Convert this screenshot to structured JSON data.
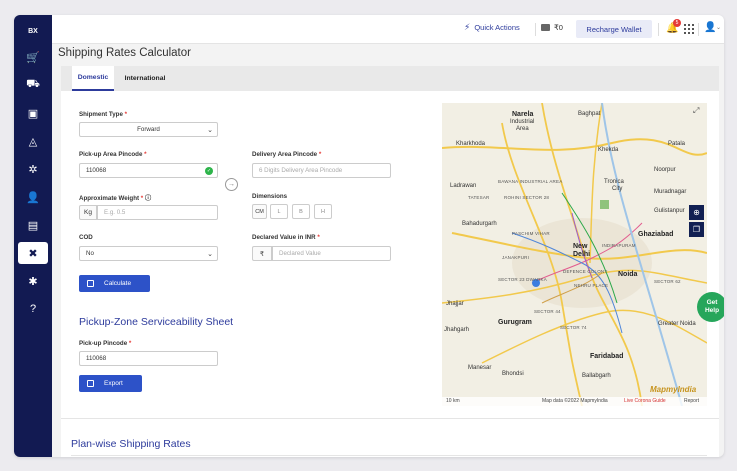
{
  "sidebar": {
    "logo": "BX",
    "items": [
      {
        "icon": "cart-icon",
        "glyph": "🛒"
      },
      {
        "icon": "box-icon",
        "glyph": "⛟"
      },
      {
        "icon": "package-icon",
        "glyph": "▣"
      },
      {
        "icon": "bag-icon",
        "glyph": "◬"
      },
      {
        "icon": "network-icon",
        "glyph": "✲"
      },
      {
        "icon": "user-check-icon",
        "glyph": "👤"
      },
      {
        "icon": "document-icon",
        "glyph": "▤"
      },
      {
        "icon": "tools-icon",
        "glyph": "✖",
        "active": true
      },
      {
        "icon": "settings-icon",
        "glyph": "✱"
      },
      {
        "icon": "help-icon",
        "glyph": "?"
      }
    ]
  },
  "topbar": {
    "quick_actions": "Quick Actions",
    "wallet_balance": "₹0",
    "recharge_label": "Recharge Wallet",
    "notification_count": "5"
  },
  "page": {
    "title": "Shipping Rates Calculator"
  },
  "tabs": [
    {
      "label": "Domestic",
      "active": true
    },
    {
      "label": "International",
      "active": false
    }
  ],
  "form": {
    "shipment_type": {
      "label": "Shipment Type",
      "value": "Forward"
    },
    "pickup_pincode": {
      "label": "Pick-up Area Pincode",
      "value": "110068"
    },
    "delivery_pincode": {
      "label": "Delivery Area Pincode",
      "placeholder": "6 Digits Delivery Area Pincode"
    },
    "weight": {
      "label": "Approximate Weight",
      "unit": "Kg",
      "placeholder": "E.g. 0.5"
    },
    "dimensions": {
      "label": "Dimensions",
      "unit": "CM",
      "l": "L",
      "b": "B",
      "h": "H"
    },
    "cod": {
      "label": "COD",
      "value": "No"
    },
    "declared_value": {
      "label": "Declared Value in INR",
      "currency": "₹",
      "placeholder": "Declared Value"
    },
    "calculate_label": "Calculate"
  },
  "serviceability": {
    "title": "Pickup-Zone Serviceability Sheet",
    "pincode_label": "Pick-up Pincode",
    "pincode_value": "110068",
    "export_label": "Export"
  },
  "plan_rates": {
    "title": "Plan-wise Shipping Rates"
  },
  "map": {
    "labels": {
      "narela": "Narela",
      "baghpat": "Baghpat",
      "industrial": "Industrial",
      "area": "Area",
      "kharkhoda": "Kharkhoda",
      "khekda": "Khekda",
      "patala": "Patala",
      "tronica": "Tronica",
      "city": "City",
      "ladrawan": "Ladrawan",
      "noorpur": "Noorpur",
      "bawana": "BAWANA INDUSTRIAL AREA",
      "tatesar": "TATESAR",
      "rohini": "ROHINI SECTOR 28",
      "muradnagar": "Muradnagar",
      "gulistanpur": "Gulistanpur",
      "bahadurgarh": "Bahadurgarh",
      "paschim": "PASCHIM VIHAR",
      "ghaziabad": "Ghaziabad",
      "indirapuram": "INDIRAPURAM",
      "janakpuri": "JANAKPURI",
      "newdelhi1": "New",
      "newdelhi2": "Delhi",
      "defence": "DEFENCE COLONY",
      "noida": "Noida",
      "nehru": "NEHRU PLACE",
      "sector23": "SECTOR 23 DWARKA",
      "sector62": "SECTOR 62",
      "jhajjar": "Jhajjar",
      "sector44": "SECTOR 44",
      "gurugram": "Gurugram",
      "sector74": "SECTOR 74",
      "greater_noida": "Greater Noida",
      "jhahgarh": "Jhahgarh",
      "faridabad": "Faridabad",
      "manesar": "Manesar",
      "bhondsi": "Bhondsi",
      "ballabgarh": "Ballabgarh",
      "mapmyindia": "MapmyIndia"
    },
    "footer_scale": "10 km",
    "footer_data": "Map data ©2022 MapmyIndia",
    "footer_corona": "Live Corona Guide",
    "footer_report": "Report",
    "get_help_1": "Get",
    "get_help_2": "Help"
  }
}
